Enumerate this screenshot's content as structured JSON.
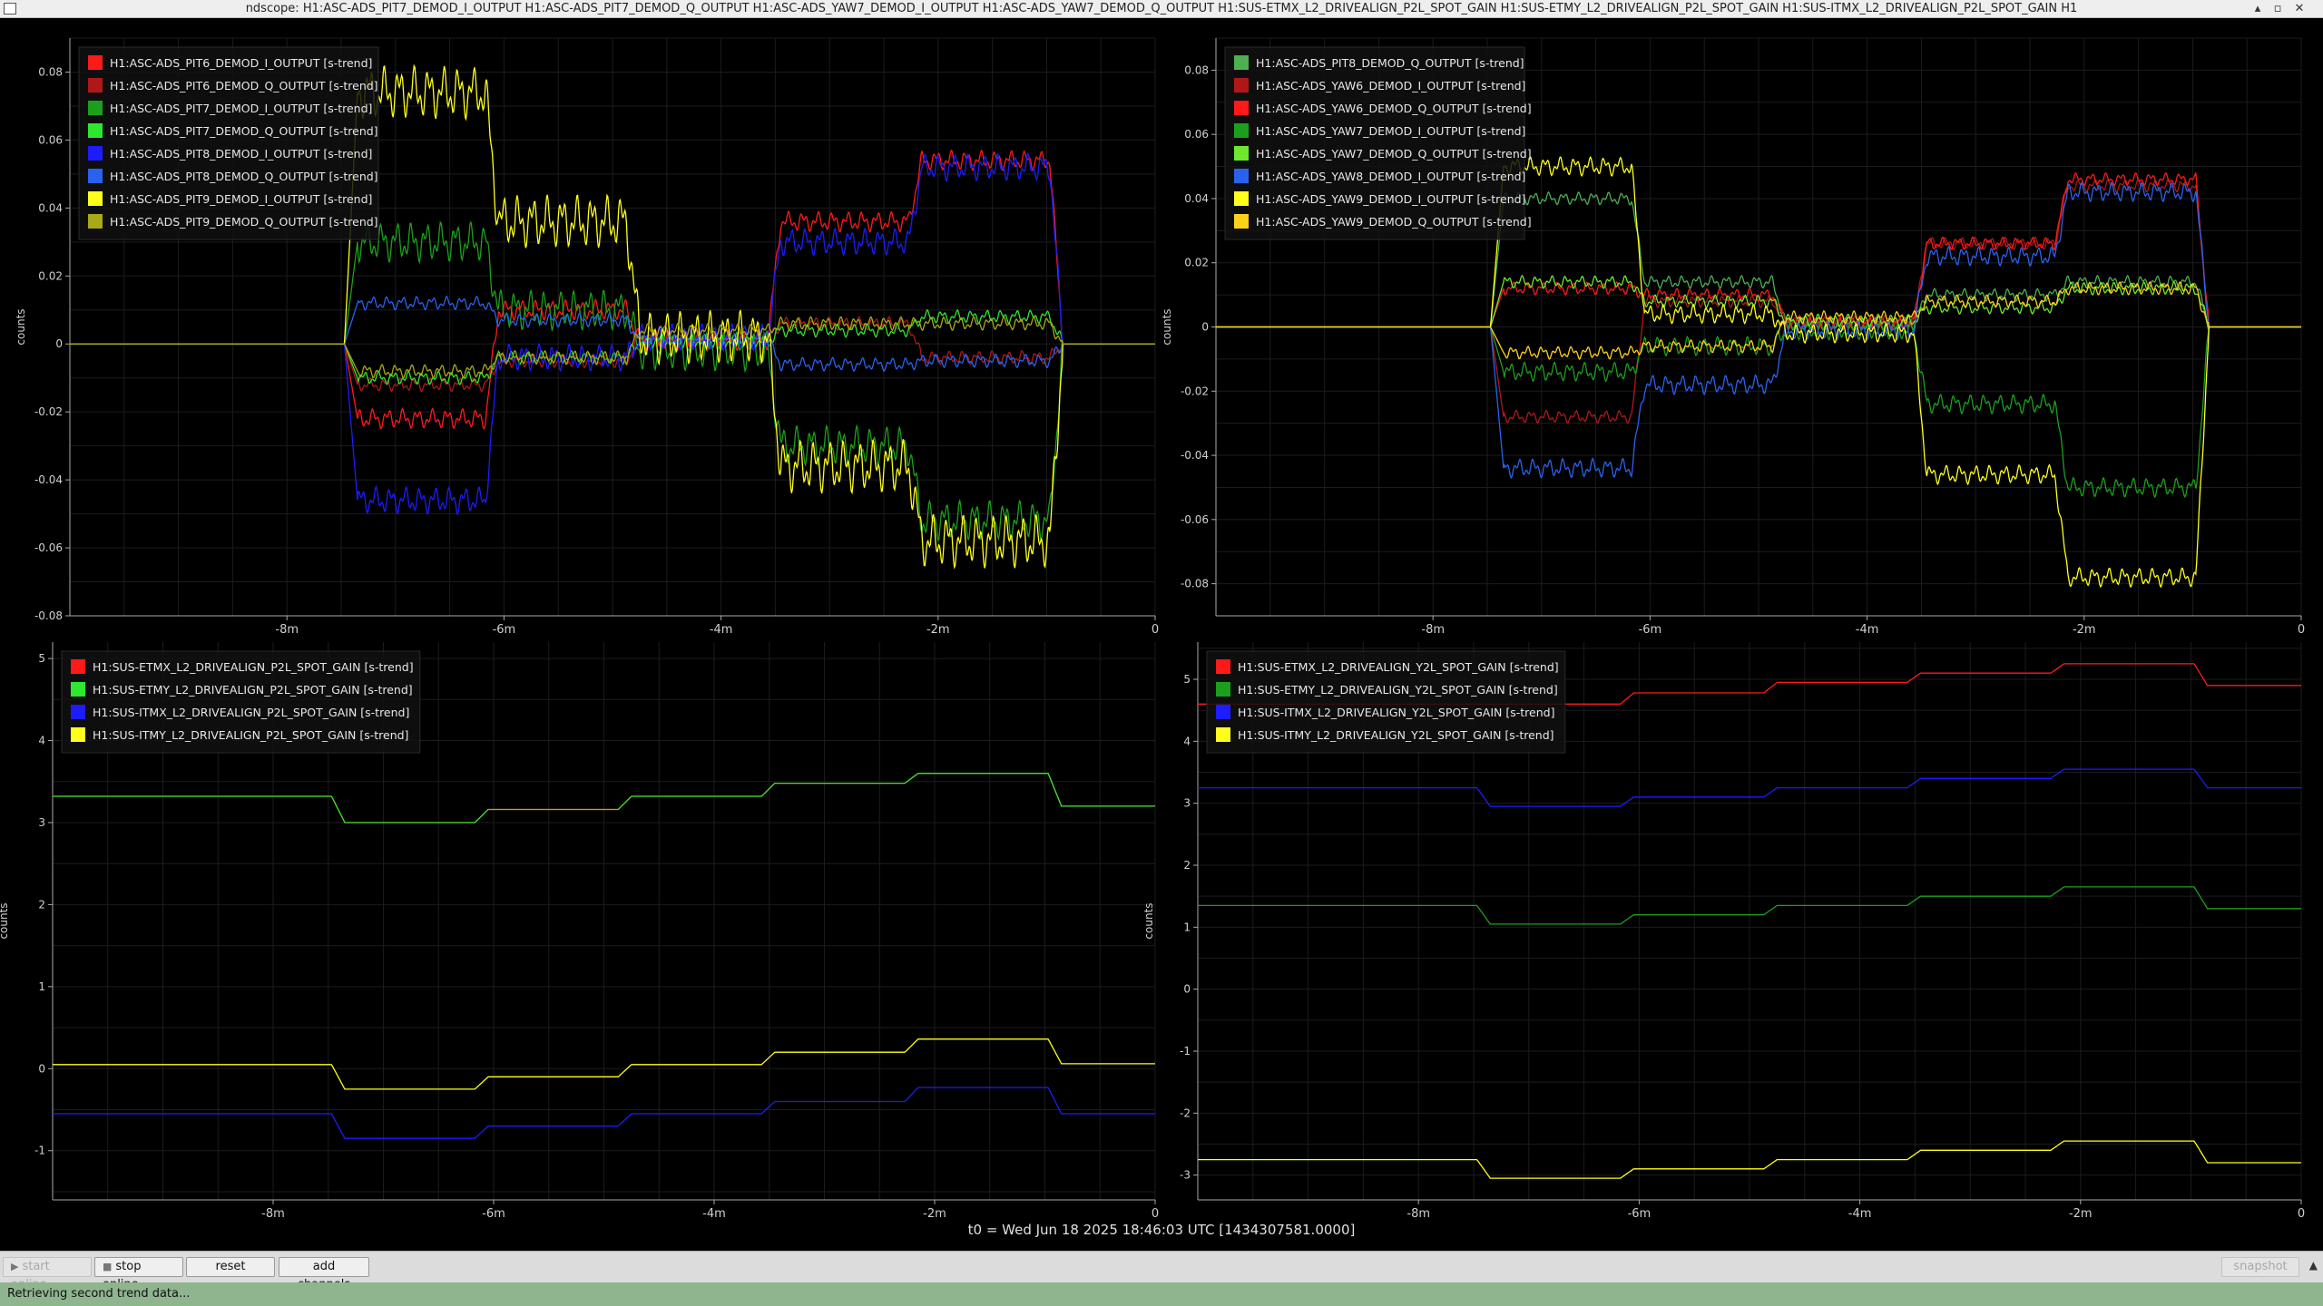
{
  "window": {
    "title": "ndscope: H1:ASC-ADS_PIT7_DEMOD_I_OUTPUT H1:ASC-ADS_PIT7_DEMOD_Q_OUTPUT H1:ASC-ADS_YAW7_DEMOD_I_OUTPUT H1:ASC-ADS_YAW7_DEMOD_Q_OUTPUT H1:SUS-ETMX_L2_DRIVEALIGN_P2L_SPOT_GAIN H1:SUS-ETMY_L2_DRIVEALIGN_P2L_SPOT_GAIN H1:SUS-ITMX_L2_DRIVEALIGN_P2L_SPOT_GAIN H1",
    "controls": [
      "▴",
      "▫",
      "✕"
    ]
  },
  "t0_label": "t0 = Wed Jun 18 2025 18:46:03 UTC [1434307581.0000]",
  "toolbar": {
    "start_online": "start online",
    "stop_online": "stop online",
    "reset": "reset",
    "add_channels": "add channels",
    "snapshot": "snapshot"
  },
  "status": "Retrieving second trend data...",
  "chart_data": [
    {
      "id": "tl",
      "type": "line",
      "ylabel": "counts",
      "ylim": [
        -0.08,
        0.09
      ],
      "yticks": [
        -0.08,
        -0.06,
        -0.04,
        -0.02,
        0,
        0.02,
        0.04,
        0.06,
        0.08
      ],
      "ytick_labels": [
        "-0.08",
        "-0.06",
        "-0.04",
        "-0.02",
        "0",
        "0.02",
        "0.04",
        "0.06",
        "0.08"
      ],
      "xlim": [
        -10,
        0
      ],
      "xticks": [
        -8,
        -6,
        -4,
        -2,
        0
      ],
      "xtick_labels": [
        "-8m",
        "-6m",
        "-4m",
        "-2m",
        "0"
      ],
      "legend_position": "top-left",
      "segments": [
        -10,
        -7.35,
        -6.05,
        -4.75,
        -3.45,
        -2.15,
        -0.85,
        0
      ],
      "series": [
        {
          "name": "H1:ASC-ADS_PIT6_DEMOD_I_OUTPUT [s-trend]",
          "color": "#ff1a1a",
          "levels": [
            0,
            -0.022,
            0.01,
            0.001,
            0.036,
            0.054,
            0
          ],
          "ripple": 0.003
        },
        {
          "name": "H1:ASC-ADS_PIT6_DEMOD_Q_OUTPUT [s-trend]",
          "color": "#b01818",
          "levels": [
            0,
            -0.012,
            -0.005,
            0.002,
            0.006,
            -0.004,
            0
          ],
          "ripple": 0.002
        },
        {
          "name": "H1:ASC-ADS_PIT7_DEMOD_I_OUTPUT [s-trend]",
          "color": "#1ca01c",
          "levels": [
            0,
            0.03,
            0.01,
            -0.002,
            -0.03,
            -0.052,
            0
          ],
          "ripple": 0.006
        },
        {
          "name": "H1:ASC-ADS_PIT7_DEMOD_Q_OUTPUT [s-trend]",
          "color": "#2ee82e",
          "levels": [
            0,
            -0.01,
            -0.004,
            0.001,
            0.004,
            0.008,
            0
          ],
          "ripple": 0.002
        },
        {
          "name": "H1:ASC-ADS_PIT8_DEMOD_I_OUTPUT [s-trend]",
          "color": "#1c1cff",
          "levels": [
            0,
            -0.046,
            -0.004,
            0.002,
            0.03,
            0.052,
            0
          ],
          "ripple": 0.004
        },
        {
          "name": "H1:ASC-ADS_PIT8_DEMOD_Q_OUTPUT [s-trend]",
          "color": "#2a62f0",
          "levels": [
            0,
            0.012,
            0.007,
            0.001,
            -0.006,
            -0.005,
            0
          ],
          "ripple": 0.002
        },
        {
          "name": "H1:ASC-ADS_PIT9_DEMOD_I_OUTPUT [s-trend]",
          "color": "#ffff1a",
          "levels": [
            0,
            0.074,
            0.036,
            0.002,
            -0.036,
            -0.058,
            0
          ],
          "ripple": 0.008
        },
        {
          "name": "H1:ASC-ADS_PIT9_DEMOD_Q_OUTPUT [s-trend]",
          "color": "#a8a818",
          "levels": [
            0,
            -0.008,
            -0.004,
            0.004,
            0.006,
            0.006,
            0
          ],
          "ripple": 0.002
        }
      ]
    },
    {
      "id": "tr",
      "type": "line",
      "ylabel": "counts",
      "ylim": [
        -0.09,
        0.09
      ],
      "yticks": [
        -0.08,
        -0.06,
        -0.04,
        -0.02,
        0,
        0.02,
        0.04,
        0.06,
        0.08
      ],
      "ytick_labels": [
        "-0.08",
        "-0.06",
        "-0.04",
        "-0.02",
        "0",
        "0.02",
        "0.04",
        "0.06",
        "0.08"
      ],
      "xlim": [
        -10,
        0
      ],
      "xticks": [
        -8,
        -6,
        -4,
        -2,
        0
      ],
      "xtick_labels": [
        "-8m",
        "-6m",
        "-4m",
        "-2m",
        "0"
      ],
      "legend_position": "top-left",
      "segments": [
        -10,
        -7.35,
        -6.05,
        -4.75,
        -3.45,
        -2.15,
        -0.85,
        0
      ],
      "series": [
        {
          "name": "H1:ASC-ADS_PIT8_DEMOD_Q_OUTPUT [s-trend]",
          "color": "#4caf50",
          "levels": [
            0,
            0.04,
            0.014,
            0.001,
            0.01,
            0.014,
            0
          ],
          "ripple": 0.002
        },
        {
          "name": "H1:ASC-ADS_YAW6_DEMOD_I_OUTPUT [s-trend]",
          "color": "#b01818",
          "levels": [
            0,
            -0.028,
            0.008,
            0.002,
            0.026,
            0.044,
            0
          ],
          "ripple": 0.002
        },
        {
          "name": "H1:ASC-ADS_YAW6_DEMOD_Q_OUTPUT [s-trend]",
          "color": "#ff1a1a",
          "levels": [
            0,
            0.012,
            0.01,
            0.001,
            0.026,
            0.046,
            0
          ],
          "ripple": 0.002
        },
        {
          "name": "H1:ASC-ADS_YAW7_DEMOD_I_OUTPUT [s-trend]",
          "color": "#1ca01c",
          "levels": [
            0,
            -0.014,
            -0.006,
            -0.001,
            -0.024,
            -0.05,
            0
          ],
          "ripple": 0.003
        },
        {
          "name": "H1:ASC-ADS_YAW7_DEMOD_Q_OUTPUT [s-trend]",
          "color": "#6ee82e",
          "levels": [
            0,
            0.014,
            0.008,
            0.002,
            0.006,
            0.012,
            0
          ],
          "ripple": 0.002
        },
        {
          "name": "H1:ASC-ADS_YAW8_DEMOD_I_OUTPUT [s-trend]",
          "color": "#2a62f0",
          "levels": [
            0,
            -0.044,
            -0.018,
            -0.001,
            0.022,
            0.042,
            0
          ],
          "ripple": 0.003
        },
        {
          "name": "H1:ASC-ADS_YAW9_DEMOD_I_OUTPUT [s-trend]",
          "color": "#ffff1a",
          "levels": [
            0,
            0.05,
            0.004,
            -0.002,
            -0.046,
            -0.078,
            0
          ],
          "ripple": 0.003
        },
        {
          "name": "H1:ASC-ADS_YAW9_DEMOD_Q_OUTPUT [s-trend]",
          "color": "#ffd21a",
          "levels": [
            0,
            -0.008,
            -0.006,
            0.003,
            0.008,
            0.012,
            0
          ],
          "ripple": 0.002
        }
      ]
    },
    {
      "id": "bl",
      "type": "line",
      "ylabel": "counts",
      "ylim": [
        -1.6,
        5.2
      ],
      "yticks": [
        -1,
        0,
        1,
        2,
        3,
        4,
        5
      ],
      "ytick_labels": [
        "-1",
        "0",
        "1",
        "2",
        "3",
        "4",
        "5"
      ],
      "xlim": [
        -10,
        0
      ],
      "xticks": [
        -8,
        -6,
        -4,
        -2,
        0
      ],
      "xtick_labels": [
        "-8m",
        "-6m",
        "-4m",
        "-2m",
        "0"
      ],
      "legend_position": "top-left",
      "segments": [
        -10,
        -7.35,
        -6.05,
        -4.75,
        -3.45,
        -2.15,
        -0.85,
        0
      ],
      "series": [
        {
          "name": "H1:SUS-ETMX_L2_DRIVEALIGN_P2L_SPOT_GAIN [s-trend]",
          "color": "#ff1a1a",
          "levels": [
            3.32,
            3.0,
            3.16,
            3.32,
            3.48,
            3.6,
            3.2
          ],
          "ripple": 0
        },
        {
          "name": "H1:SUS-ETMY_L2_DRIVEALIGN_P2L_SPOT_GAIN [s-trend]",
          "color": "#2ee82e",
          "levels": [
            3.32,
            3.0,
            3.16,
            3.32,
            3.48,
            3.6,
            3.2
          ],
          "ripple": 0
        },
        {
          "name": "H1:SUS-ITMX_L2_DRIVEALIGN_P2L_SPOT_GAIN [s-trend]",
          "color": "#1c1cff",
          "levels": [
            -0.55,
            -0.85,
            -0.7,
            -0.55,
            -0.4,
            -0.23,
            -0.55
          ],
          "ripple": 0
        },
        {
          "name": "H1:SUS-ITMY_L2_DRIVEALIGN_P2L_SPOT_GAIN [s-trend]",
          "color": "#ffff1a",
          "levels": [
            0.05,
            -0.25,
            -0.1,
            0.05,
            0.2,
            0.36,
            0.06
          ],
          "ripple": 0
        }
      ]
    },
    {
      "id": "br",
      "type": "line",
      "ylabel": "counts",
      "ylim": [
        -3.4,
        5.6
      ],
      "yticks": [
        -3,
        -2,
        -1,
        0,
        1,
        2,
        3,
        4,
        5
      ],
      "ytick_labels": [
        "-3",
        "-2",
        "-1",
        "0",
        "1",
        "2",
        "3",
        "4",
        "5"
      ],
      "xlim": [
        -10,
        0
      ],
      "xticks": [
        -8,
        -6,
        -4,
        -2,
        0
      ],
      "xtick_labels": [
        "-8m",
        "-6m",
        "-4m",
        "-2m",
        "0"
      ],
      "legend_position": "top-left",
      "segments": [
        -10,
        -7.35,
        -6.05,
        -4.75,
        -3.45,
        -2.15,
        -0.85,
        0
      ],
      "series": [
        {
          "name": "H1:SUS-ETMX_L2_DRIVEALIGN_Y2L_SPOT_GAIN [s-trend]",
          "color": "#ff1a1a",
          "levels": [
            4.6,
            4.6,
            4.78,
            4.95,
            5.1,
            5.25,
            4.9
          ],
          "ripple": 0
        },
        {
          "name": "H1:SUS-ETMY_L2_DRIVEALIGN_Y2L_SPOT_GAIN [s-trend]",
          "color": "#1ca01c",
          "levels": [
            1.35,
            1.05,
            1.2,
            1.35,
            1.5,
            1.65,
            1.3
          ],
          "ripple": 0
        },
        {
          "name": "H1:SUS-ITMX_L2_DRIVEALIGN_Y2L_SPOT_GAIN [s-trend]",
          "color": "#1c1cff",
          "levels": [
            3.25,
            2.95,
            3.1,
            3.25,
            3.4,
            3.55,
            3.25
          ],
          "ripple": 0
        },
        {
          "name": "H1:SUS-ITMY_L2_DRIVEALIGN_Y2L_SPOT_GAIN [s-trend]",
          "color": "#ffff1a",
          "levels": [
            -2.75,
            -3.05,
            -2.9,
            -2.75,
            -2.6,
            -2.45,
            -2.8
          ],
          "ripple": 0
        }
      ]
    }
  ]
}
